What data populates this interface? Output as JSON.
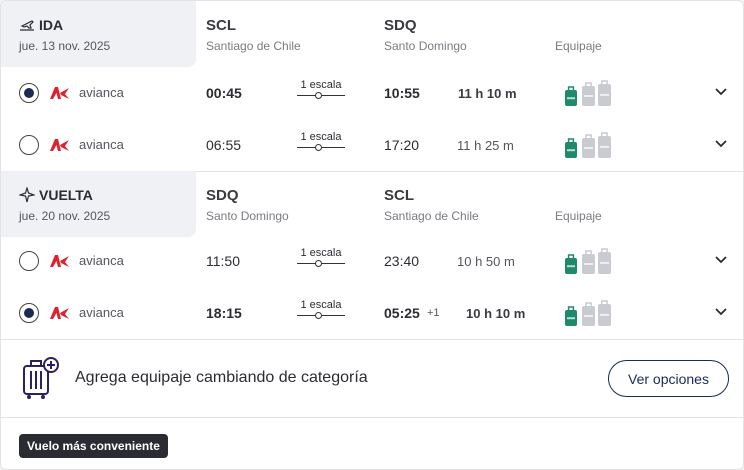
{
  "outbound": {
    "label": "IDA",
    "date": "jue. 13 nov. 2025",
    "origin_code": "SCL",
    "origin_city": "Santiago de Chile",
    "dest_code": "SDQ",
    "dest_city": "Santo Domingo",
    "luggage_label": "Equipaje",
    "flights": [
      {
        "selected": true,
        "airline": "avianca",
        "depart": "00:45",
        "stops": "1 escala",
        "arrive": "10:55",
        "day_offset": "",
        "duration": "11 h 10 m"
      },
      {
        "selected": false,
        "airline": "avianca",
        "depart": "06:55",
        "stops": "1 escala",
        "arrive": "17:20",
        "day_offset": "",
        "duration": "11 h 25 m"
      }
    ]
  },
  "return": {
    "label": "VUELTA",
    "date": "jue. 20 nov. 2025",
    "origin_code": "SDQ",
    "origin_city": "Santo Domingo",
    "dest_code": "SCL",
    "dest_city": "Santiago de Chile",
    "luggage_label": "Equipaje",
    "flights": [
      {
        "selected": false,
        "airline": "avianca",
        "depart": "11:50",
        "stops": "1 escala",
        "arrive": "23:40",
        "day_offset": "",
        "duration": "10 h 50 m"
      },
      {
        "selected": true,
        "airline": "avianca",
        "depart": "18:15",
        "stops": "1 escala",
        "arrive": "05:25",
        "day_offset": "+1",
        "duration": "10 h 10 m"
      }
    ]
  },
  "promo": {
    "text": "Agrega equipaje cambiando de categoría",
    "button": "Ver opciones"
  },
  "badge": "Vuelo más conveniente",
  "colors": {
    "brand_navy": "#1b2a55",
    "bag_included": "#1e8a6b",
    "bag_excluded": "#c9cbd1",
    "airline_red": "#e0202e",
    "header_bg": "#f0f1f4"
  },
  "icons": {
    "departure": "plane-takeoff-icon",
    "return": "plane-return-icon",
    "luggage_promo": "luggage-plus-icon",
    "expand": "chevron-down-icon"
  }
}
